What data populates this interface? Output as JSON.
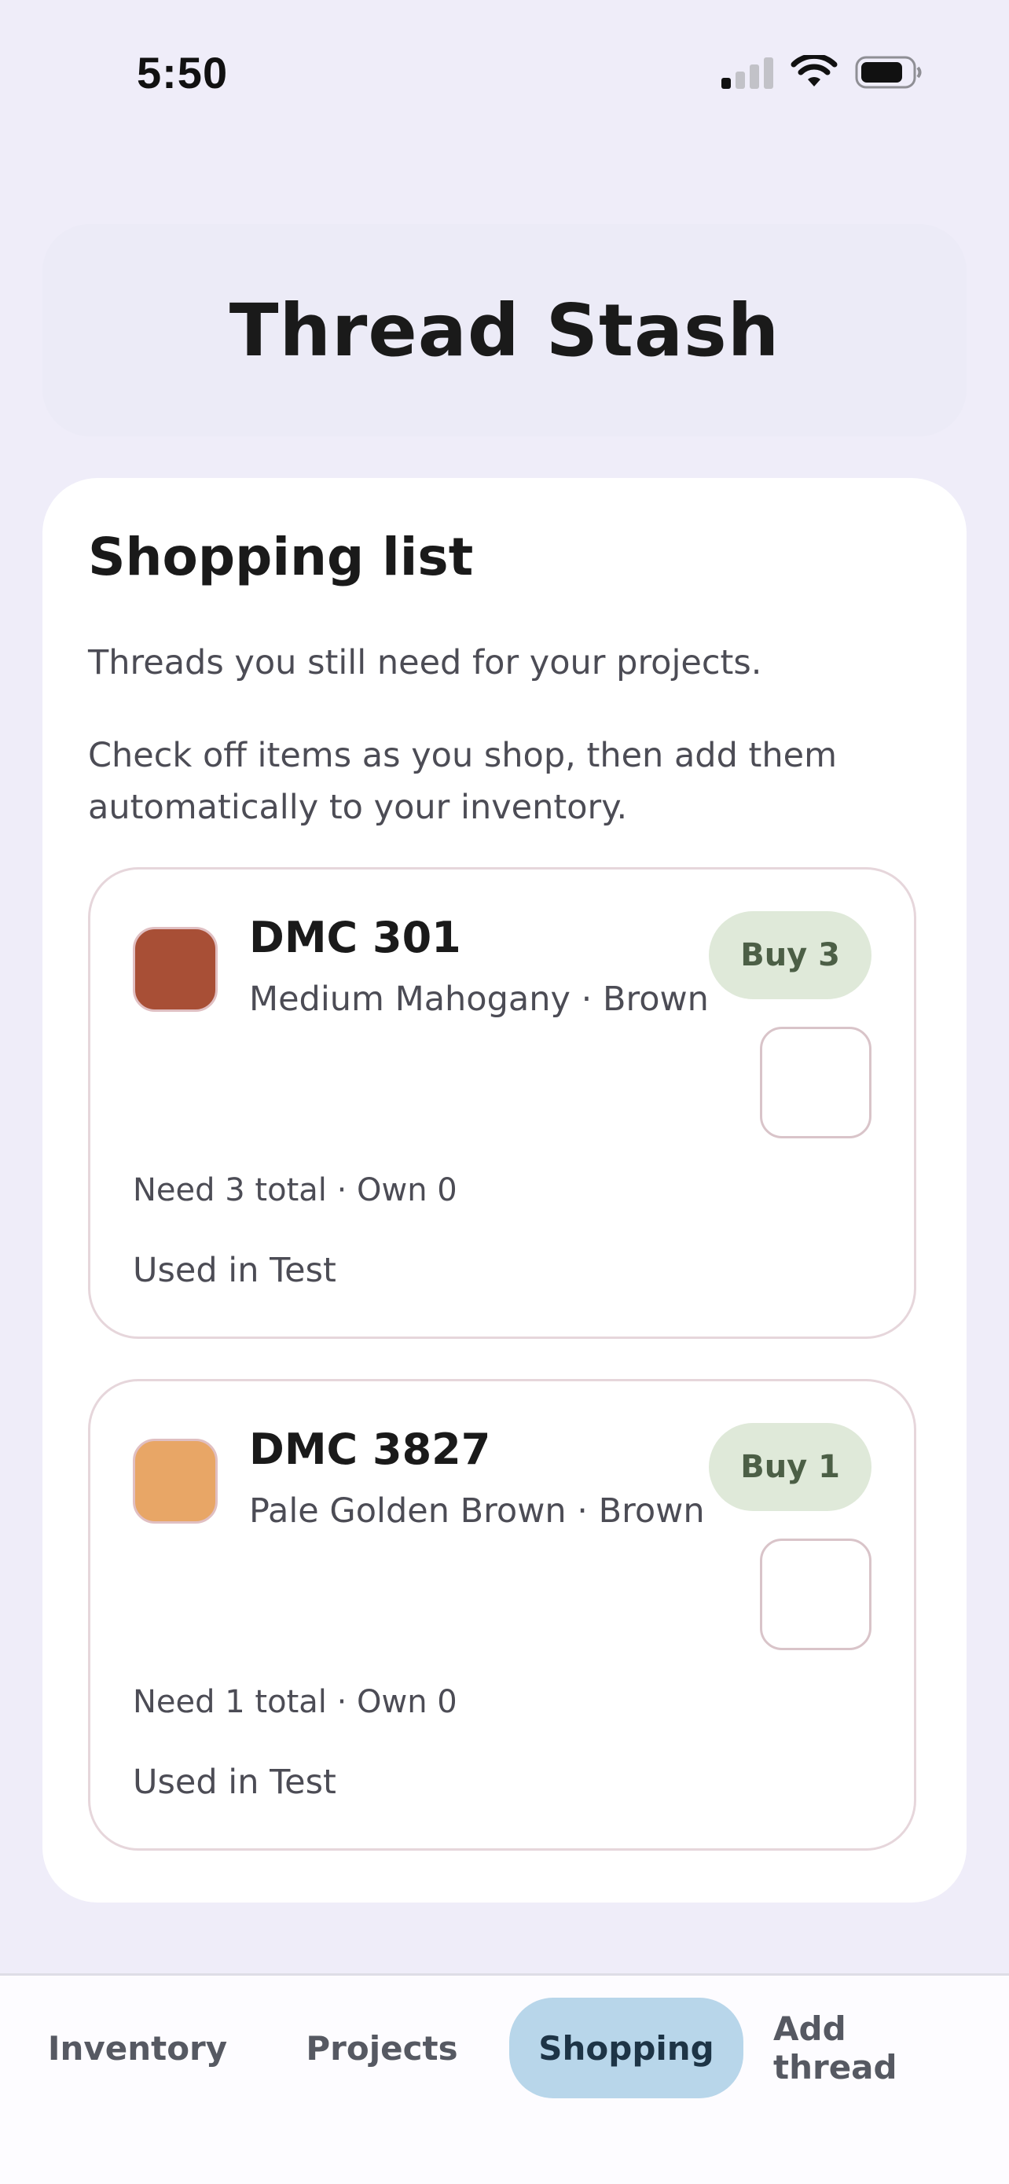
{
  "status_bar": {
    "time": "5:50"
  },
  "header": {
    "title": "Thread Stash"
  },
  "shopping": {
    "title": "Shopping list",
    "subtitle": "Threads you still need for your projects.",
    "help": "Check off items as you shop, then add them automatically to your inventory.",
    "items": [
      {
        "code": "DMC 301",
        "description": "Medium Mahogany · Brown",
        "swatch_color": "#a84f36",
        "buy_label": "Buy 3",
        "need_text": "Need 3 total · Own 0",
        "used_text": "Used in Test",
        "checked": false
      },
      {
        "code": "DMC 3827",
        "description": "Pale Golden Brown · Brown",
        "swatch_color": "#e8a666",
        "buy_label": "Buy 1",
        "need_text": "Need 1 total · Own 0",
        "used_text": "Used in Test",
        "checked": false
      }
    ]
  },
  "tabs": [
    {
      "label": "Inventory",
      "active": false
    },
    {
      "label": "Projects",
      "active": false
    },
    {
      "label": "Shopping",
      "active": true
    },
    {
      "label": "Add thread",
      "active": false
    }
  ],
  "colors": {
    "background": "#efedf9",
    "active_tab": "#b8d6ea",
    "buy_badge": "#dfe9d9"
  }
}
